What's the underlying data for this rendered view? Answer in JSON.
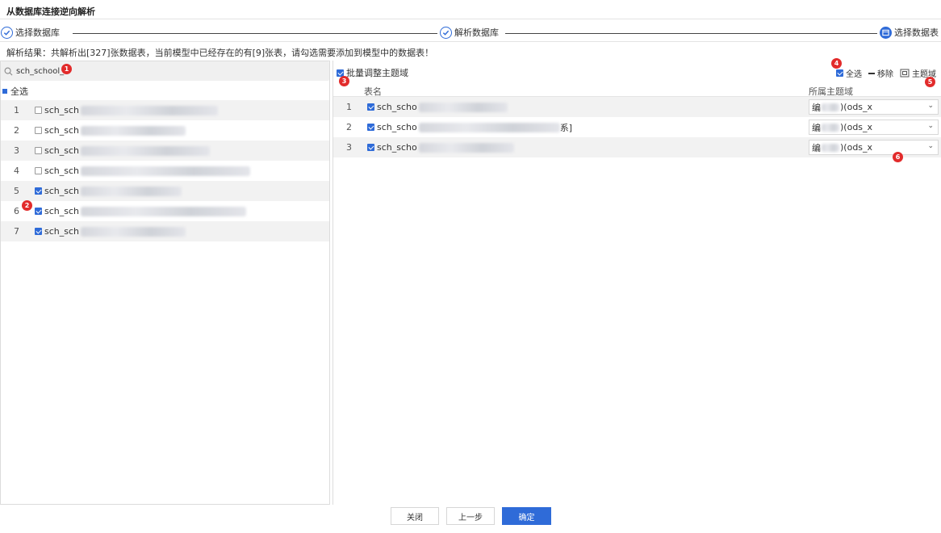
{
  "dialog": {
    "title": "从数据库连接逆向解析"
  },
  "steps": [
    {
      "label": "选择数据库",
      "state": "done"
    },
    {
      "label": "解析数据库",
      "state": "done"
    },
    {
      "label": "选择数据表",
      "state": "active"
    }
  ],
  "summary": "解析结果：共解析出[327]张数据表，当前模型中已经存在的有[9]张表，请勾选需要添加到模型中的数据表！",
  "left": {
    "search_value": "sch_school_",
    "select_all_label": "全选",
    "rows": [
      {
        "num": "1",
        "name": "sch_sch",
        "checked": false
      },
      {
        "num": "2",
        "name": "sch_sch",
        "checked": false
      },
      {
        "num": "3",
        "name": "sch_sch",
        "checked": false
      },
      {
        "num": "4",
        "name": "sch_sch",
        "checked": false
      },
      {
        "num": "5",
        "name": "sch_sch",
        "checked": true
      },
      {
        "num": "6",
        "name": "sch_sch",
        "checked": true
      },
      {
        "num": "7",
        "name": "sch_sch",
        "checked": true
      }
    ]
  },
  "right": {
    "batch_label": "批量调整主题域",
    "toolbar": {
      "select_all": "全选",
      "remove": "移除",
      "domain": "主题域"
    },
    "columns": {
      "table_name": "表名",
      "domain": "所属主题域"
    },
    "rows": [
      {
        "num": "1",
        "name": "sch_scho",
        "suffix": "",
        "domain_prefix": "编",
        "domain_value": ")(ods_x"
      },
      {
        "num": "2",
        "name": "sch_scho",
        "suffix": "系]",
        "domain_prefix": "编",
        "domain_value": ")(ods_x"
      },
      {
        "num": "3",
        "name": "sch_scho",
        "suffix": "",
        "domain_prefix": "编",
        "domain_value": ")(ods_x"
      }
    ]
  },
  "badges": [
    "1",
    "2",
    "3",
    "4",
    "5",
    "6"
  ],
  "footer": {
    "close": "关闭",
    "prev": "上一步",
    "confirm": "确定"
  },
  "colors": {
    "primary": "#2f6bd8",
    "badge": "#e22b2b"
  }
}
